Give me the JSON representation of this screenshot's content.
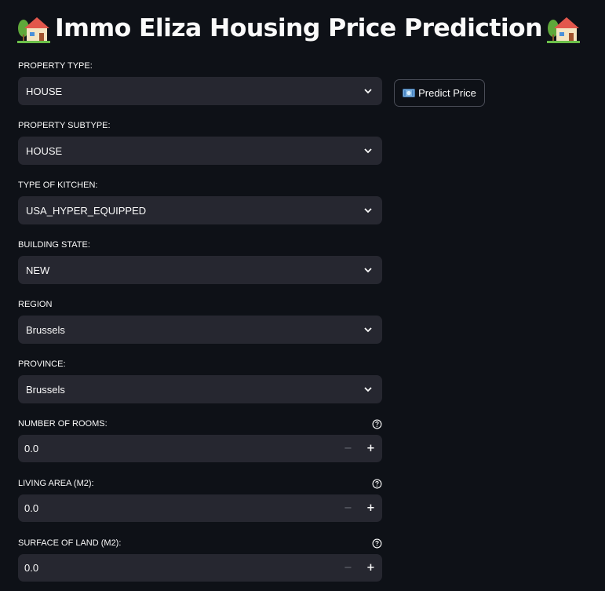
{
  "header": {
    "title": "Immo Eliza Housing Price Prediction",
    "left_icon": "house-with-garden-icon",
    "right_icon": "house-with-garden-icon"
  },
  "form": {
    "property_type": {
      "label": "PROPERTY TYPE:",
      "value": "HOUSE"
    },
    "property_subtype": {
      "label": "PROPERTY SUBTYPE:",
      "value": "HOUSE"
    },
    "kitchen_type": {
      "label": "TYPE OF KITCHEN:",
      "value": "USA_HYPER_EQUIPPED"
    },
    "building_state": {
      "label": "BUILDING STATE:",
      "value": "NEW"
    },
    "region": {
      "label": "REGION",
      "value": "Brussels"
    },
    "province": {
      "label": "PROVINCE:",
      "value": "Brussels"
    },
    "rooms": {
      "label": "NUMBER OF ROOMS:",
      "value": "0.0",
      "minus": "−",
      "plus": "+"
    },
    "living_area": {
      "label": "LIVING AREA (M2):",
      "value": "0.0",
      "minus": "−",
      "plus": "+"
    },
    "land_surface": {
      "label": "SURFACE OF LAND (M2):",
      "value": "0.0",
      "minus": "−",
      "plus": "+"
    }
  },
  "actions": {
    "predict_label": "Predict Price",
    "predict_icon": "banknote-icon"
  },
  "colors": {
    "background": "#0e1117",
    "widget": "#262730",
    "text": "#fafafa"
  }
}
